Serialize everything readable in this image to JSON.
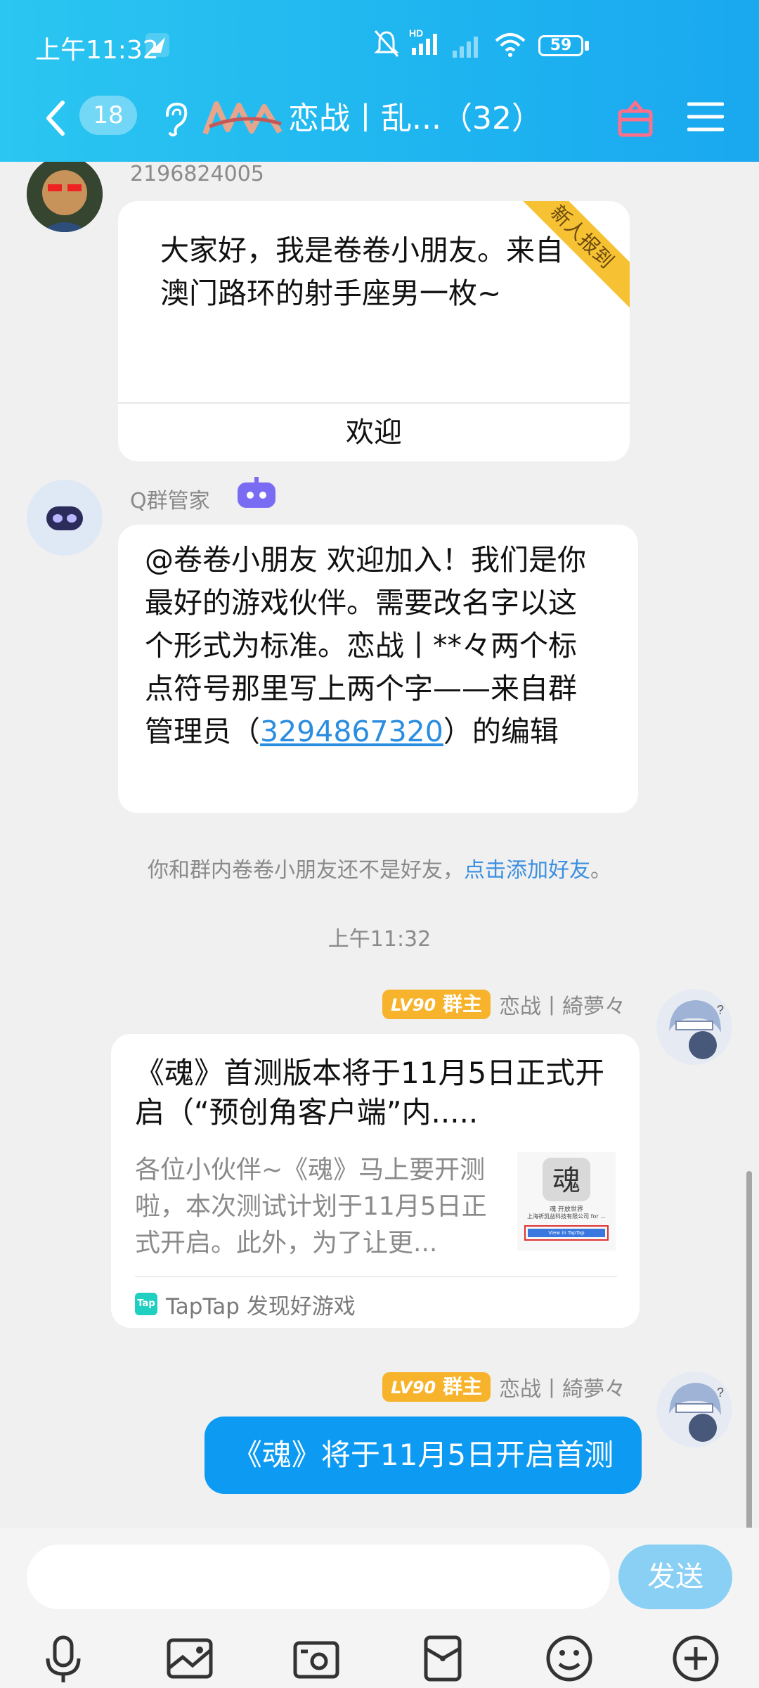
{
  "status": {
    "time": "上午11:32",
    "battery": "59"
  },
  "nav": {
    "unread_count": "18",
    "title": "恋战丨乱...（32）"
  },
  "messages": {
    "m1": {
      "sender": "2196824005",
      "ribbon": "新人报到",
      "text": "大家好，我是卷卷小朋友。来自澳门路环的射手座男一枚~",
      "action": "欢迎"
    },
    "m2": {
      "sender": "Q群管家",
      "text_before": "@卷卷小朋友 欢迎加入！我们是你最好的游戏伙伴。需要改名字以这个形式为标准。恋战丨**々两个标点符号那里写上两个字——来自群管理员（",
      "link": "3294867320",
      "text_after": "）的编辑"
    },
    "system_notice": {
      "text": "你和群内卷卷小朋友还不是好友，",
      "link": "点击添加好友",
      "suffix": "。"
    },
    "timestamp": "上午11:32",
    "m3": {
      "level": "LV90",
      "role": "群主",
      "sender": "恋战丨綺夢々",
      "card_title": "《魂》首测版本将于11月5日正式开启（“预创角客户端”内.....",
      "card_desc": "各位小伙伴~《魂》马上要开测啦，本次测试计划于11月5日正式开启。此外，为了让更...",
      "thumb_caption_1": "魂 开放世界",
      "thumb_caption_2": "上海祈凯益科技有限公司 for ...",
      "thumb_button": "View in TapTap",
      "source_badge": "Tap",
      "source": "TapTap 发现好游戏"
    },
    "m4": {
      "level": "LV90",
      "role": "群主",
      "sender": "恋战丨綺夢々",
      "text": "《魂》将于11月5日开启首测"
    }
  },
  "input": {
    "placeholder": "",
    "send_label": "发送"
  },
  "colors": {
    "header": "#1eb4f0",
    "self_bubble": "#0c9af2",
    "link": "#2a8de0",
    "owner_badge": "#f7b32b",
    "ribbon": "#f6c233"
  }
}
